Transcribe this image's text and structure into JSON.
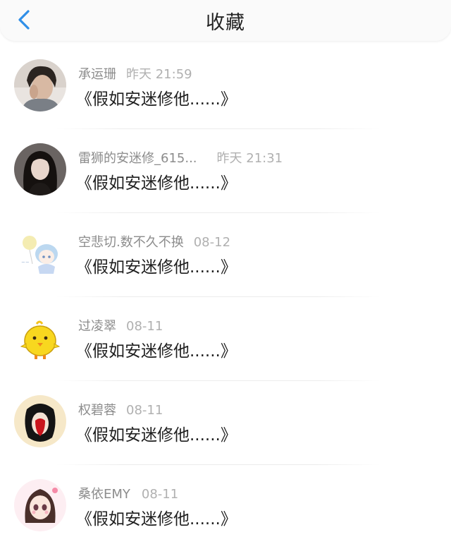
{
  "header": {
    "title": "收藏",
    "back_icon": "chevron-left-icon",
    "accent_color": "#2f8fe8"
  },
  "items": [
    {
      "name": "承运珊",
      "time": "昨天 21:59",
      "content": "《假如安迷修他......》",
      "avatar": "avatar-photo-man"
    },
    {
      "name": "雷狮的安迷修_615...",
      "time": "昨天 21:31",
      "content": "《假如安迷修他......》",
      "avatar": "avatar-photo-woman"
    },
    {
      "name": "空悲切.数不久不换",
      "time": "08-12",
      "content": "《假如安迷修他......》",
      "avatar": "avatar-anime-girl-balloon"
    },
    {
      "name": "过凌翠",
      "time": "08-11",
      "content": "《假如安迷修他......》",
      "avatar": "avatar-yellow-chick"
    },
    {
      "name": "权碧蓉",
      "time": "08-11",
      "content": "《假如安迷修他......》",
      "avatar": "avatar-illustration-red"
    },
    {
      "name": "桑依EMY",
      "time": "08-11",
      "content": "《假如安迷修他......》",
      "avatar": "avatar-anime-girl-pink"
    }
  ]
}
